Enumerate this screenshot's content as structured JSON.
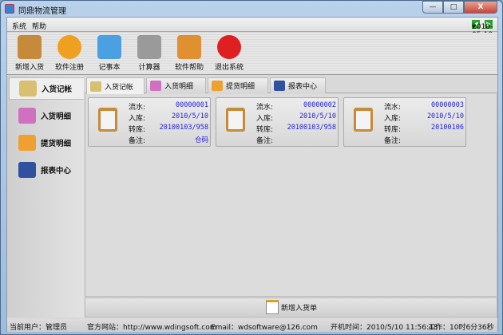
{
  "window": {
    "title": "同鼎物流管理",
    "minimize": "—",
    "maximize": "□",
    "close": "X"
  },
  "menu": [
    "系统",
    "帮助"
  ],
  "date": {
    "value": "2010-05-10",
    "prev": "◀",
    "next": "▶",
    "dropdown": "▾"
  },
  "toolbar": [
    {
      "label": "新增入货",
      "icon": "clipboard-icon",
      "color": "#c58a3a"
    },
    {
      "label": "软件注册",
      "icon": "key-icon",
      "color": "#f0a020"
    },
    {
      "label": "记事本",
      "icon": "notebook-icon",
      "color": "#4aa0e0"
    },
    {
      "label": "计算器",
      "icon": "calculator-icon",
      "color": "#9a9a9a"
    },
    {
      "label": "软件帮助",
      "icon": "help-icon",
      "color": "#e09030"
    },
    {
      "label": "退出系统",
      "icon": "power-icon",
      "color": "#e02020"
    }
  ],
  "sidebar": [
    {
      "label": "入货记帐",
      "icon": "notepad-pencil-icon",
      "color": "#d8c070"
    },
    {
      "label": "入货明细",
      "icon": "butterfly-icon",
      "color": "#d070c0"
    },
    {
      "label": "提货明细",
      "icon": "flower-box-icon",
      "color": "#f0a030"
    },
    {
      "label": "报表中心",
      "icon": "binders-icon",
      "color": "#3050a0"
    }
  ],
  "tabs": [
    {
      "label": "入货记帐",
      "color": "#d8c070"
    },
    {
      "label": "入货明细",
      "color": "#d070c0"
    },
    {
      "label": "提货明细",
      "color": "#f0a030"
    },
    {
      "label": "报表中心",
      "color": "#3050a0"
    }
  ],
  "field_labels": {
    "serial": "流水:",
    "in": "入库:",
    "transfer": "转库:",
    "note": "备注:"
  },
  "cards": [
    {
      "serial": "00000001",
      "in": "2010/5/10",
      "transfer": "20100103/958",
      "note": "仓码"
    },
    {
      "serial": "00000002",
      "in": "2010/5/10",
      "transfer": "20100103/958",
      "note": ""
    },
    {
      "serial": "00000003",
      "in": "2010/5/10",
      "transfer": "20100106",
      "note": ""
    }
  ],
  "new_order_button": "新增入货单",
  "status": {
    "user": "当前用户：管理员",
    "site": "官方网站：http://www.wdingsoft.com",
    "email": "Email：wdsoftware@126.com",
    "boot": "开机时间：2010/5/10 11:56:48",
    "work": "工作：10时6分36秒"
  }
}
